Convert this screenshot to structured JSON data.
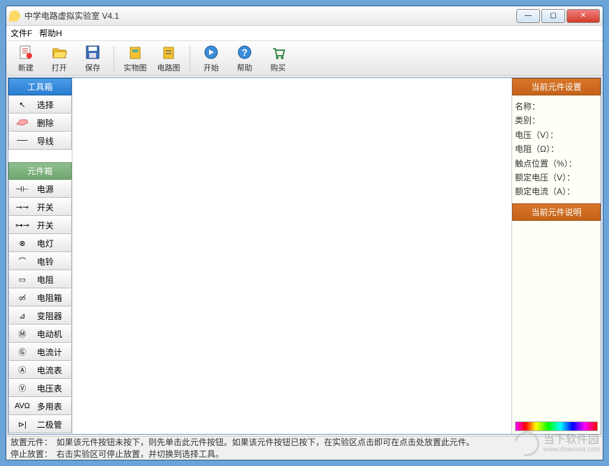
{
  "window": {
    "title": "中学电路虚拟实验室 V4.1"
  },
  "menu": {
    "file": "文件F",
    "help": "帮助H"
  },
  "toolbar": {
    "new": "新建",
    "open": "打开",
    "save": "保存",
    "physical": "实物图",
    "circuit": "电路图",
    "start": "开始",
    "help": "帮助",
    "buy": "购买"
  },
  "toolbox": {
    "header": "工具箱",
    "select": "选择",
    "delete": "删除",
    "wire": "导线"
  },
  "componentbox": {
    "header": "元件箱",
    "items": [
      {
        "sym": "⊣⊢",
        "label": "电源"
      },
      {
        "sym": "⊸⊸",
        "label": "开关"
      },
      {
        "sym": "⊶⊸",
        "label": "开关"
      },
      {
        "sym": "⊗",
        "label": "电灯"
      },
      {
        "sym": "⌒",
        "label": "电铃"
      },
      {
        "sym": "▭",
        "label": "电阻"
      },
      {
        "sym": "▭̸",
        "label": "电阻箱"
      },
      {
        "sym": "⊿",
        "label": "变阻器"
      },
      {
        "sym": "Ⓜ",
        "label": "电动机"
      },
      {
        "sym": "Ⓖ",
        "label": "电流计"
      },
      {
        "sym": "Ⓐ",
        "label": "电流表"
      },
      {
        "sym": "Ⓥ",
        "label": "电压表"
      },
      {
        "sym": "AVΩ",
        "label": "多用表"
      },
      {
        "sym": "⊳|",
        "label": "二极管"
      }
    ]
  },
  "props": {
    "header": "当前元件设置",
    "name": "名称：",
    "category": "类别：",
    "voltage": "电压（V）：",
    "resistance": "电阻（Ω）：",
    "contact": "触点位置（%）：",
    "ratedV": "额定电压（V）：",
    "ratedA": "额定电流（A）："
  },
  "desc": {
    "header": "当前元件说明"
  },
  "status": {
    "line1": "放置元件：　如果该元件按钮未按下，则先单击此元件按钮。如果该元件按钮已按下，在实验区点击即可在点击处放置此元件。",
    "line2": "停止放置：　右击实验区可停止放置，并切换到选择工具。"
  },
  "watermark": {
    "text": "当下软件园",
    "url": "www.downxia.com"
  }
}
